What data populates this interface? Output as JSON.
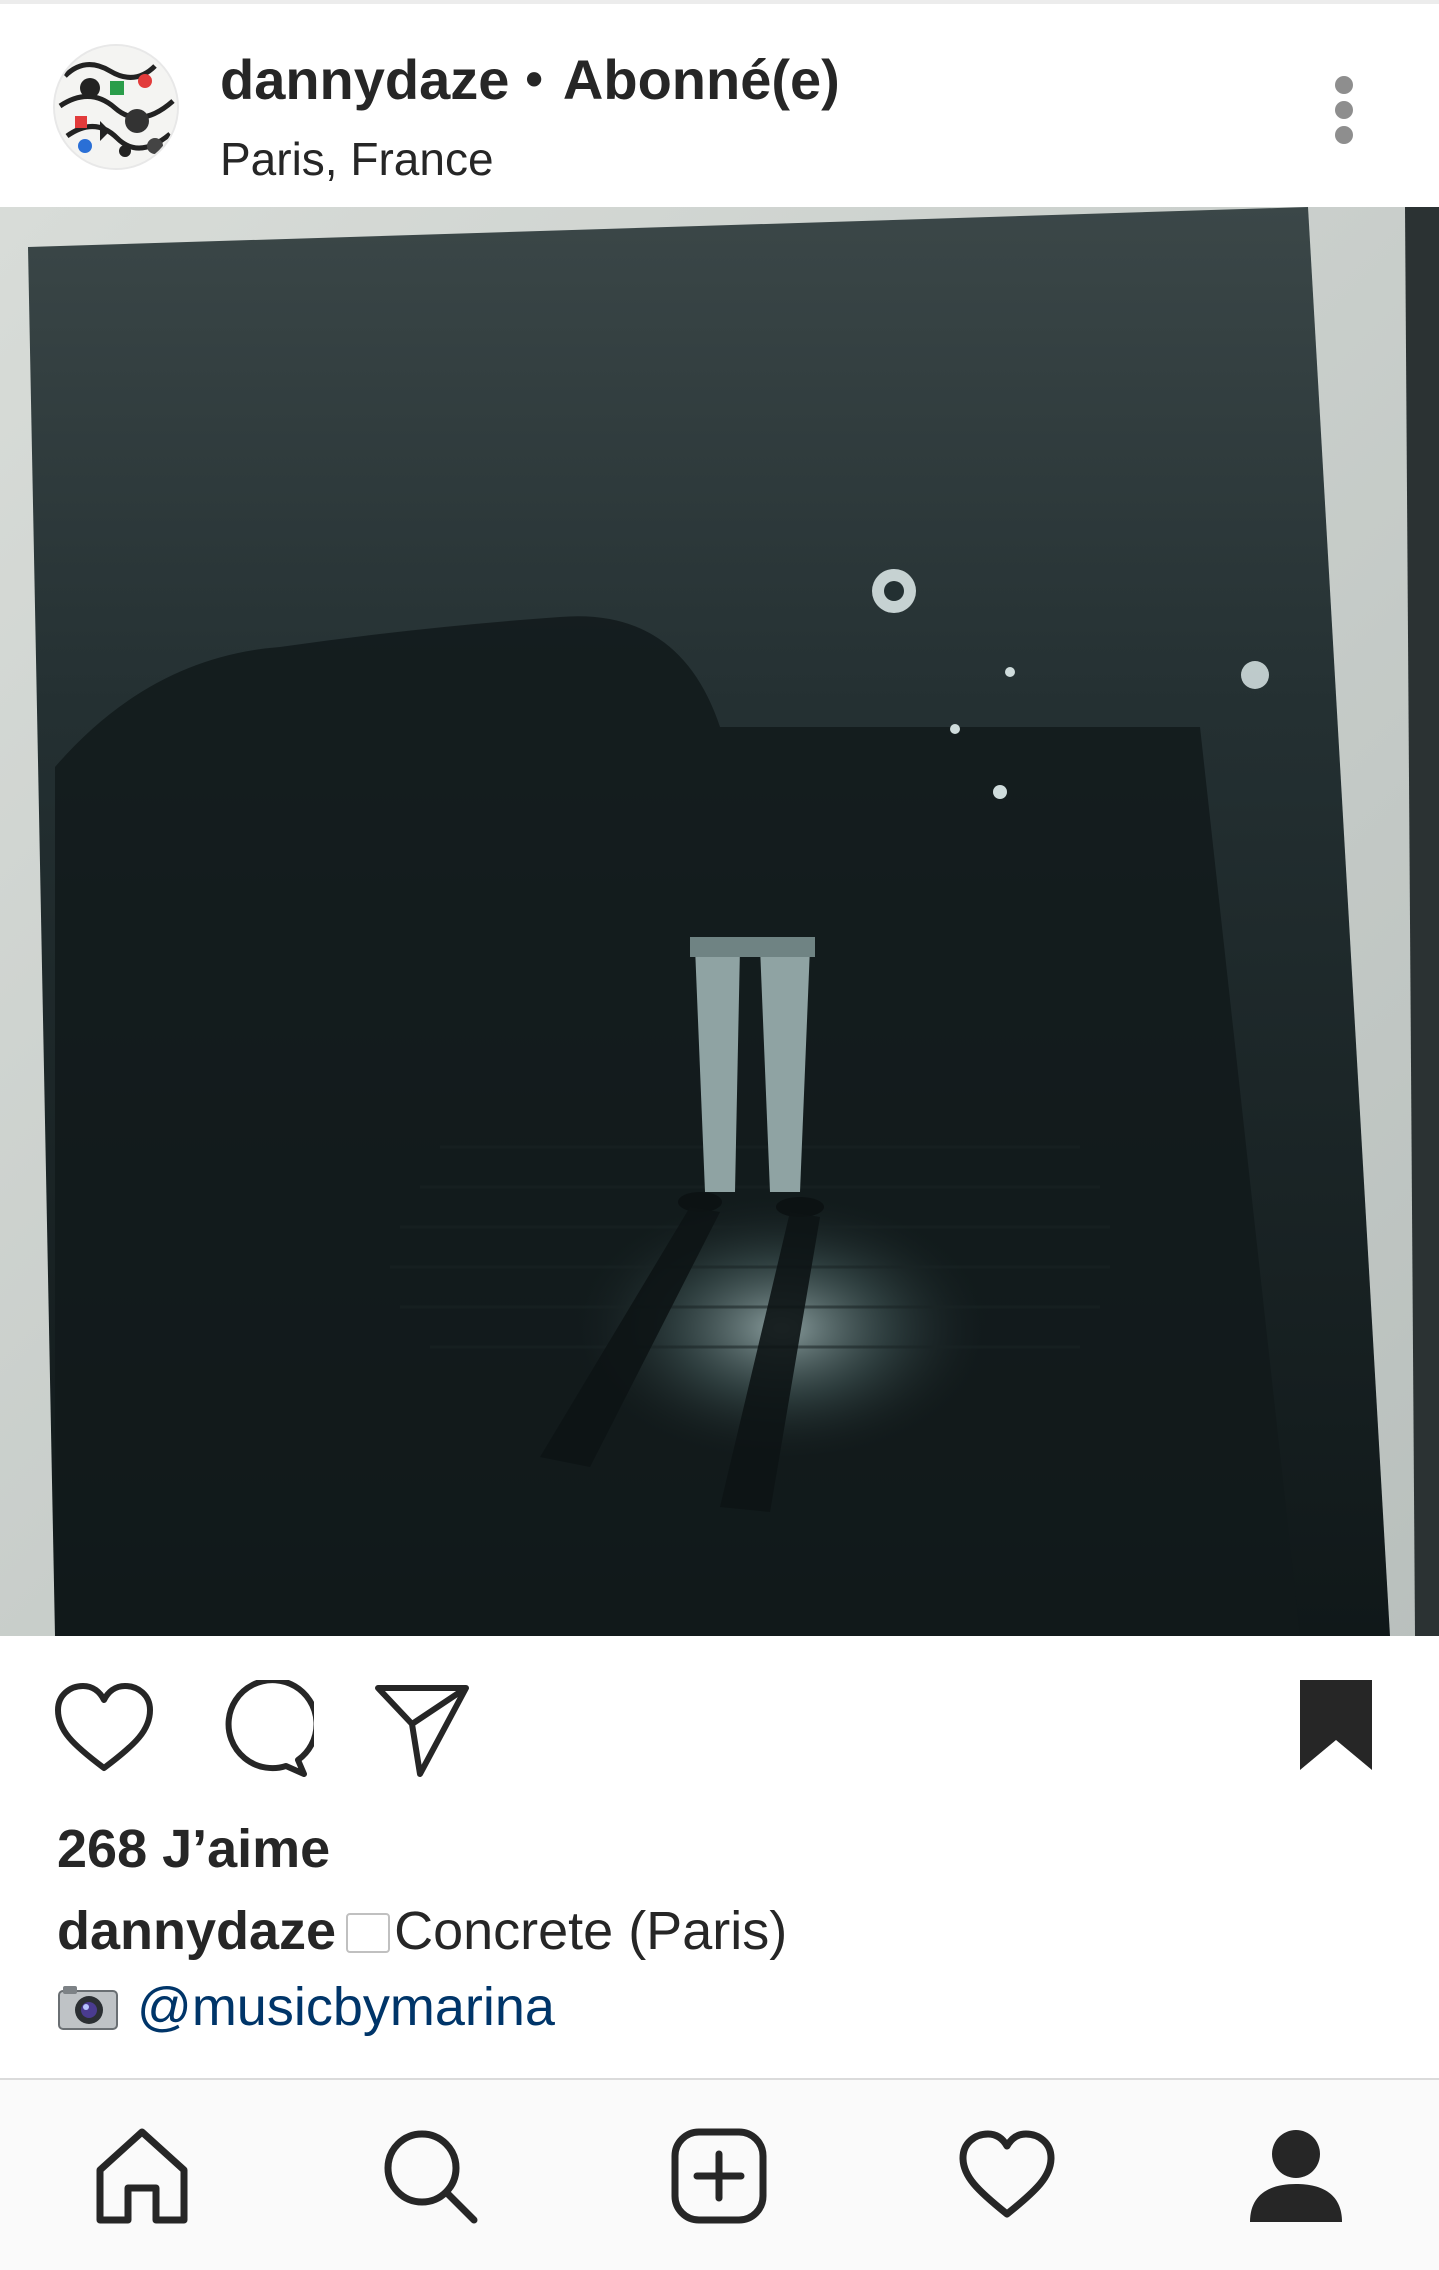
{
  "header": {
    "username": "dannydaze",
    "separator": "•",
    "follow_status": "Abonné(e)",
    "location": "Paris, France"
  },
  "post": {
    "likes_text": "268 J’aime",
    "caption_user": "dannydaze",
    "caption_text": "Concrete (Paris)",
    "credit_mention": "@musicbymarina"
  },
  "icons": {
    "avatar": "avatar",
    "more": "more-vertical-icon",
    "like": "heart-outline-icon",
    "comment": "comment-bubble-icon",
    "share": "paper-plane-icon",
    "save": "bookmark-filled-icon",
    "camera_emoji": "camera-emoji",
    "nav_home": "home-icon",
    "nav_search": "search-icon",
    "nav_add": "add-post-icon",
    "nav_activity": "heart-outline-icon",
    "nav_profile": "profile-icon"
  },
  "colors": {
    "text": "#262626",
    "mention": "#003569",
    "nav_background": "#fafafa"
  }
}
